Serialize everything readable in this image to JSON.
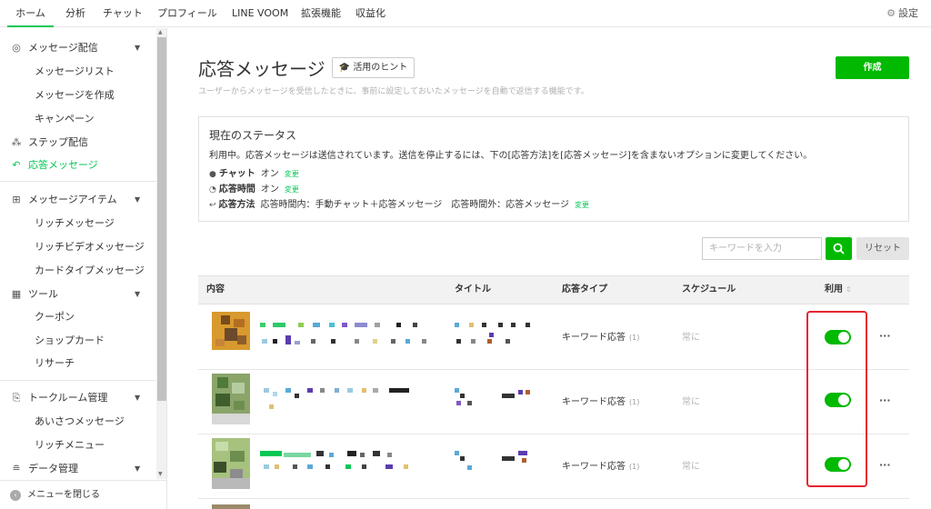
{
  "topnav": {
    "tabs": [
      "ホーム",
      "分析",
      "チャット",
      "プロフィール",
      "LINE VOOM",
      "拡張機能",
      "収益化"
    ],
    "settings_label": "設定"
  },
  "sidebar": {
    "sections": [
      {
        "icon": "broadcast-icon",
        "label": "メッセージ配信",
        "items": [
          "メッセージリスト",
          "メッセージを作成",
          "キャンペーン"
        ]
      },
      {
        "icon": "step-icon",
        "label": "ステップ配信"
      },
      {
        "icon": "reply-icon",
        "label": "応答メッセージ",
        "active": true
      },
      {
        "icon": "item-icon",
        "label": "メッセージアイテム",
        "items": [
          "リッチメッセージ",
          "リッチビデオメッセージ",
          "カードタイプメッセージ"
        ]
      },
      {
        "icon": "shop-icon",
        "label": "ツール",
        "items": [
          "クーポン",
          "ショップカード",
          "リサーチ"
        ]
      },
      {
        "icon": "chatroom-icon",
        "label": "トークルーム管理",
        "items": [
          "あいさつメッセージ",
          "リッチメニュー"
        ]
      },
      {
        "icon": "database-icon",
        "label": "データ管理"
      }
    ],
    "collapse_label": "メニューを閉じる"
  },
  "main": {
    "title": "応答メッセージ",
    "hint_label": "活用のヒント",
    "create_label": "作成",
    "description": "ユーザーからメッセージを受信したときに、事前に設定しておいたメッセージを自動で返信する機能です。",
    "status": {
      "title": "現在のステータス",
      "text": "利用中。応答メッセージは送信されています。送信を停止するには、下の[応答方法]を[応答メッセージ]を含まないオプションに変更してください。",
      "rows": [
        {
          "icon": "chat-icon",
          "label": "チャット",
          "value": "オン",
          "link": "変更"
        },
        {
          "icon": "clock-icon",
          "label": "応答時間",
          "value": "オン",
          "link": "変更"
        },
        {
          "icon": "reply-method-icon",
          "label": "応答方法",
          "value": "応答時間内：手動チャット＋応答メッセージ　応答時間外：応答メッセージ",
          "link": "変更"
        }
      ]
    },
    "search": {
      "placeholder": "キーワードを入力",
      "reset_label": "リセット"
    },
    "table": {
      "headers": {
        "content": "内容",
        "title": "タイトル",
        "type": "応答タイプ",
        "schedule": "スケジュール",
        "enabled": "利用"
      },
      "rows": [
        {
          "type": "キーワード応答",
          "count": "(1)",
          "schedule": "常に",
          "enabled": true,
          "more": "···"
        },
        {
          "type": "キーワード応答",
          "count": "(1)",
          "schedule": "常に",
          "enabled": true,
          "more": "···"
        },
        {
          "type": "キーワード応答",
          "count": "(1)",
          "schedule": "常に",
          "enabled": true,
          "more": "···"
        }
      ]
    }
  }
}
